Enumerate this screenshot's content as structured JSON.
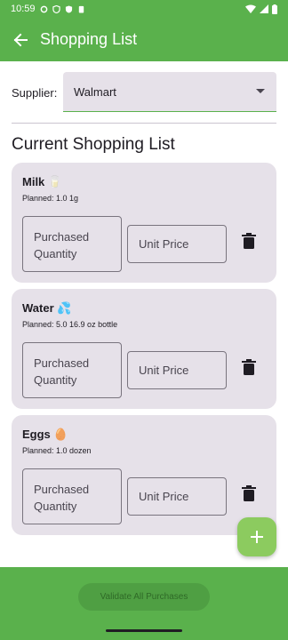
{
  "status_bar": {
    "time": "10:59",
    "icons": [
      "gear-icon",
      "shield-icon",
      "shield-alt-icon",
      "battery-saver-icon"
    ],
    "right_icons": [
      "wifi-icon",
      "signal-icon",
      "battery-icon"
    ]
  },
  "app_bar": {
    "title": "Shopping List",
    "back_icon": "arrow-left-icon"
  },
  "supplier": {
    "label": "Supplier:",
    "value": "Walmart"
  },
  "section_title": "Current Shopping List",
  "items": [
    {
      "name": "Milk 🥛",
      "planned": "Planned: 1.0 1g",
      "qty_placeholder": "Purchased Quantity",
      "price_placeholder": "Unit Price"
    },
    {
      "name": "Water 💦",
      "planned": "Planned: 5.0 16.9 oz bottle",
      "qty_placeholder": "Purchased Quantity",
      "price_placeholder": "Unit Price"
    },
    {
      "name": "Eggs 🥚",
      "planned": "Planned: 1.0 dozen",
      "qty_placeholder": "Purchased Quantity",
      "price_placeholder": "Unit Price"
    }
  ],
  "validate_button": "Validate All Purchases",
  "colors": {
    "primary": "#5ab14c",
    "card": "#e6e1e9",
    "fab": "#8ccb5f"
  }
}
